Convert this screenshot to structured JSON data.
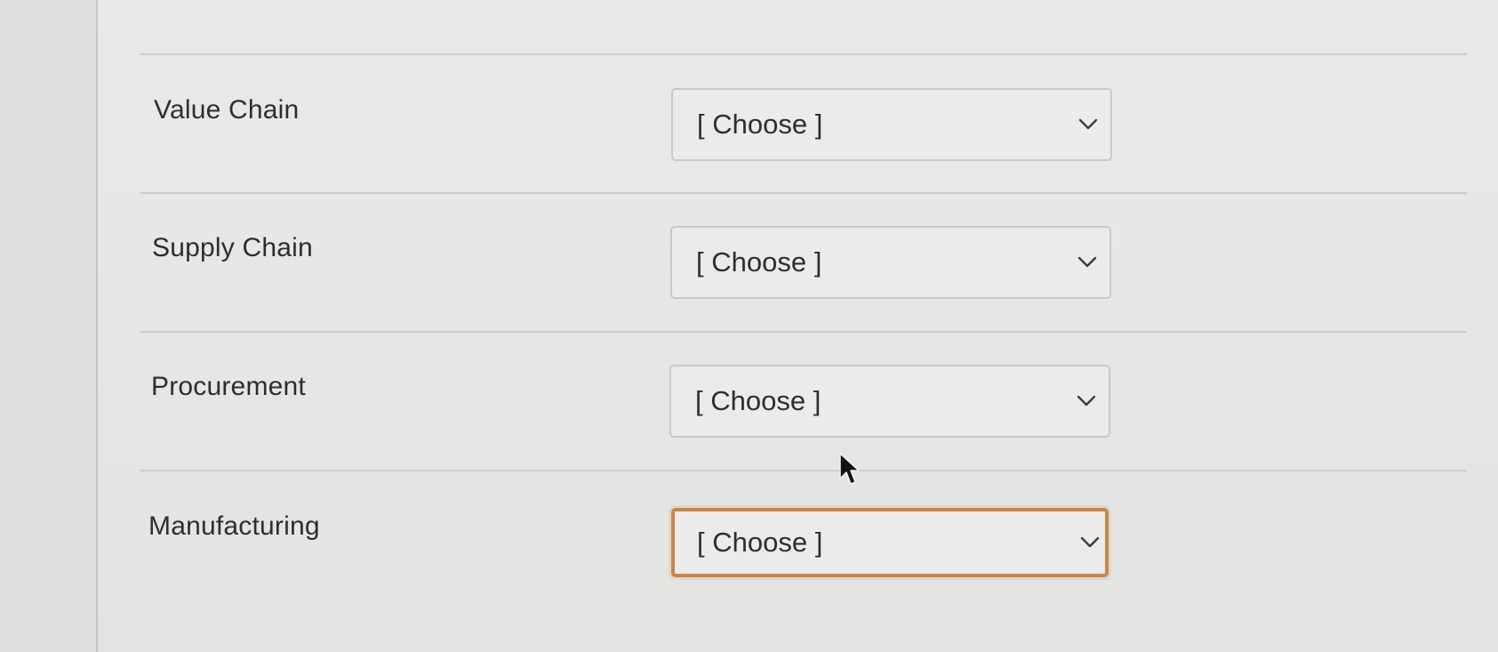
{
  "rows": [
    {
      "label": "Value Chain",
      "select_value": "[ Choose ]"
    },
    {
      "label": "Supply Chain",
      "select_value": "[ Choose ]"
    },
    {
      "label": "Procurement",
      "select_value": "[ Choose ]"
    },
    {
      "label": "Manufacturing",
      "select_value": "[ Choose ]",
      "focused": true
    }
  ],
  "icons": {
    "select_arrow": "chevron-down-icon",
    "pointer": "mouse-cursor-icon"
  },
  "colors": {
    "focus_border": "#c8864e",
    "text": "#2d2e31",
    "background": "#e8e8e7"
  }
}
